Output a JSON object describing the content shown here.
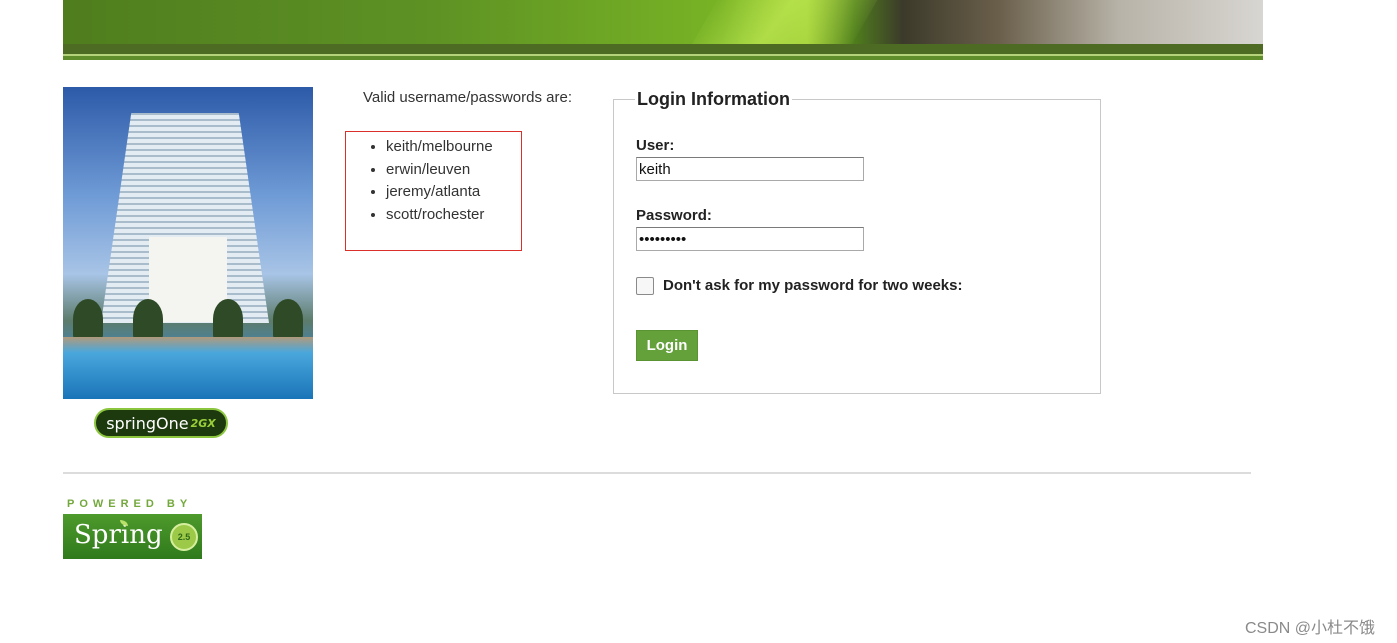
{
  "header": {
    "banner_icon": "banner-image"
  },
  "sidebar": {
    "hotel_image": "hotel-photo",
    "springone_logo": {
      "text": "springOne",
      "suffix": "2GX"
    }
  },
  "credentials": {
    "title": "Valid username/passwords are:",
    "items": [
      "keith/melbourne",
      "erwin/leuven",
      "jeremy/atlanta",
      "scott/rochester"
    ]
  },
  "login": {
    "legend": "Login Information",
    "user_label": "User:",
    "user_value": "keith",
    "password_label": "Password:",
    "password_value": "•••••••••",
    "remember_label": "Don't ask for my password for two weeks:",
    "remember_checked": false,
    "submit_label": "Login"
  },
  "footer": {
    "powered_by": "POWERED BY",
    "spring_text": "Spring",
    "spring_badge": "2.5"
  },
  "watermark": "CSDN @小杜不饿",
  "colors": {
    "accent": "#64a13a",
    "highlight_box": "#d9302c"
  }
}
